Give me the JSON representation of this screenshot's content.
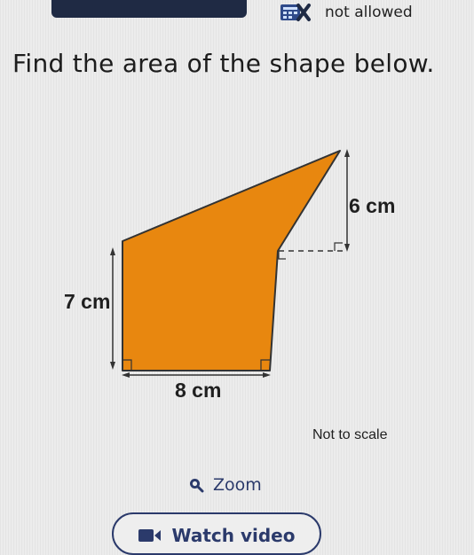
{
  "calculator": {
    "status": "not allowed",
    "icon": "calculator-crossed-icon"
  },
  "question": {
    "title": "Find the area of the shape below."
  },
  "figure": {
    "fill_color": "#e8870f",
    "outline_color": "#333333",
    "labels": {
      "slant_height": "6 cm",
      "left_side": "7 cm",
      "bottom": "8 cm"
    },
    "scale_note": "Not to scale"
  },
  "actions": {
    "zoom_label": "Zoom",
    "zoom_icon": "magnifier-icon",
    "watch_video_label": "Watch video",
    "video_icon": "video-camera-icon"
  }
}
